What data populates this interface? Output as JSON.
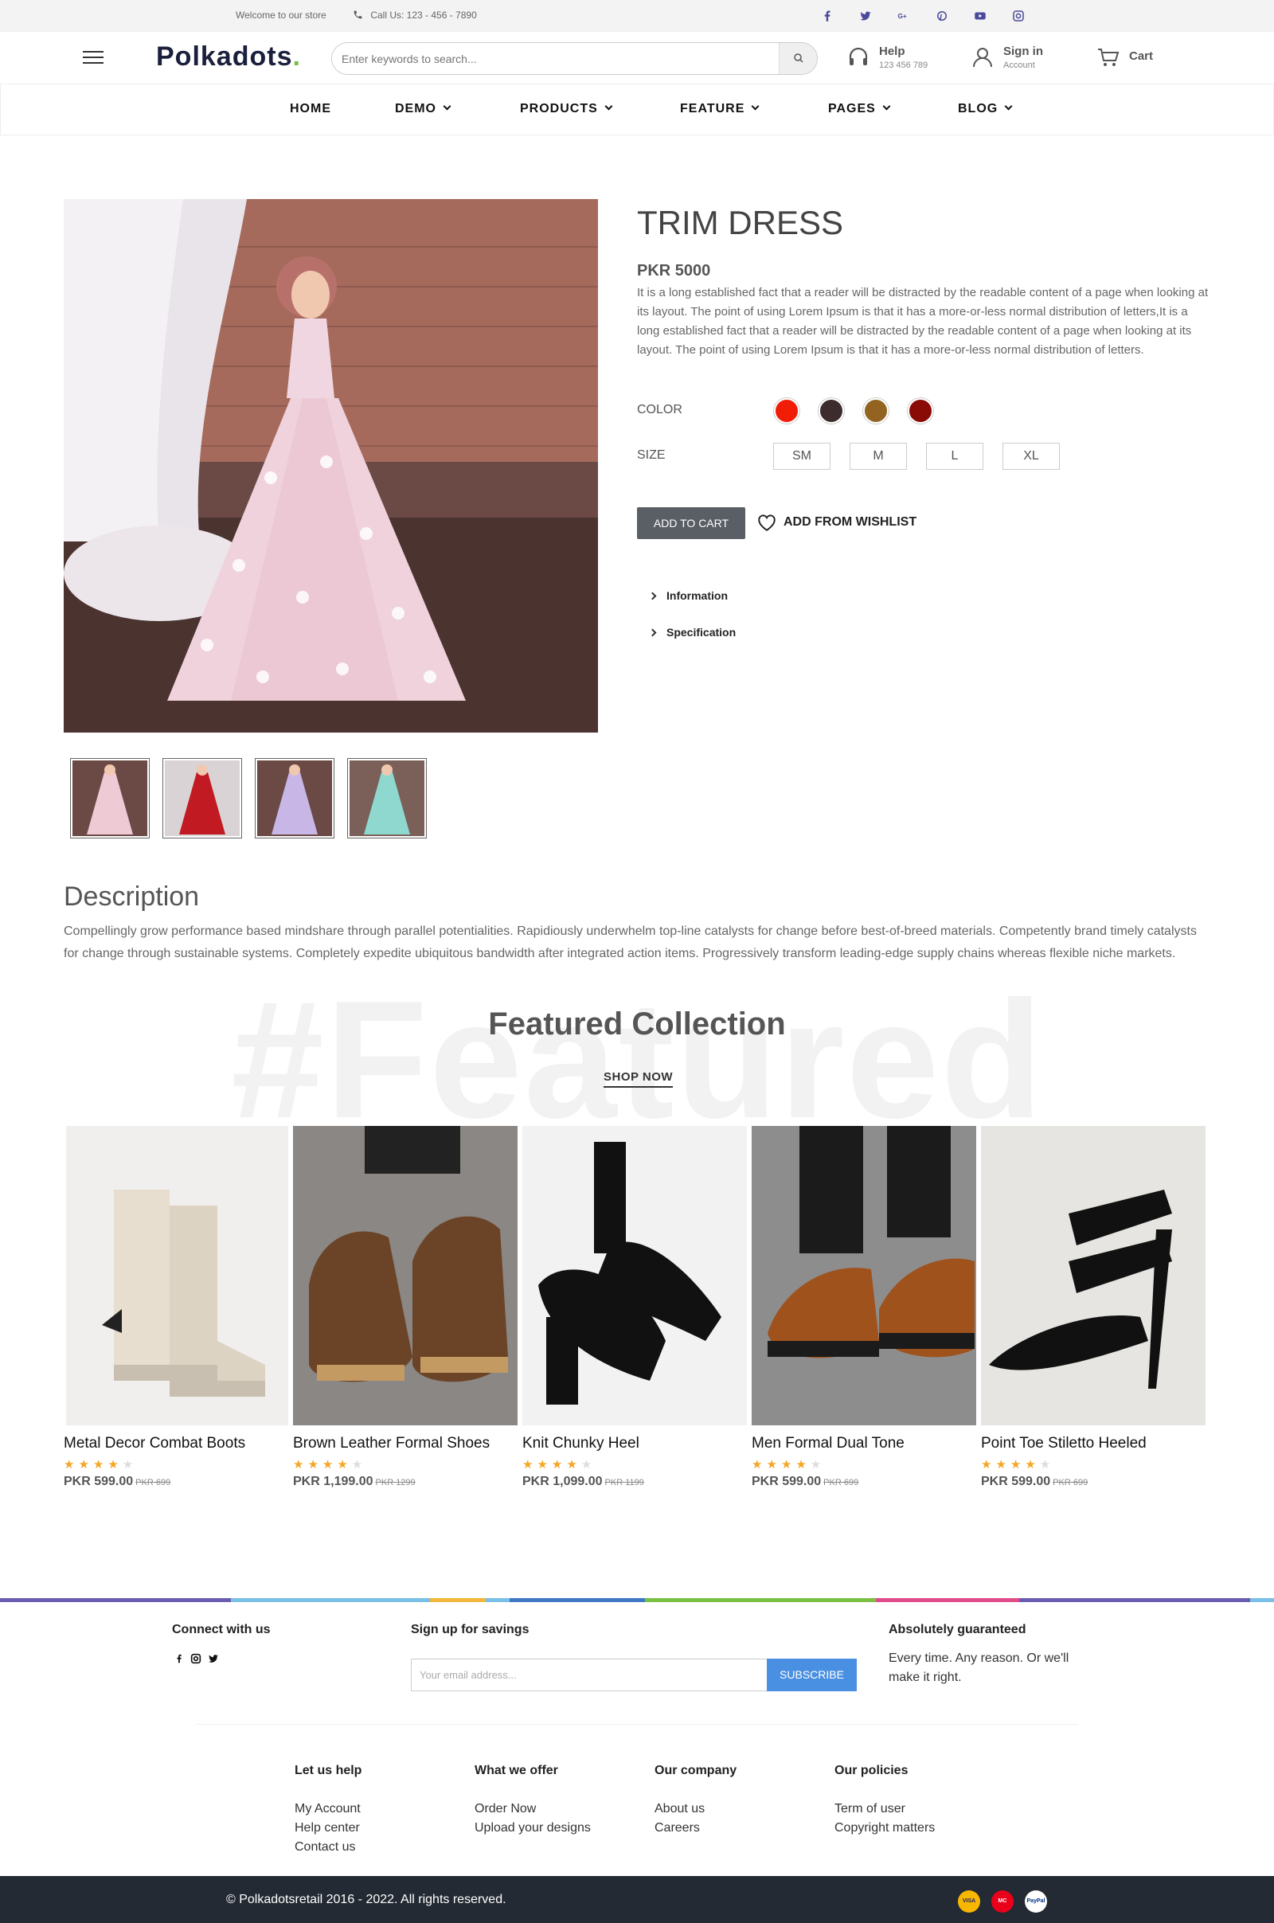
{
  "topbar": {
    "welcome": "Welcome to our store",
    "call": "Call Us: 123 - 456 - 7890"
  },
  "social_icons": [
    "facebook-icon",
    "twitter-icon",
    "google-plus-icon",
    "pinterest-icon",
    "youtube-icon",
    "instagram-icon"
  ],
  "header": {
    "logo_main": "Polkadots",
    "logo_dot": ".",
    "search_placeholder": "Enter keywords to search...",
    "help_title": "Help",
    "help_sub": "123 456 789",
    "signin_title": "Sign in",
    "signin_sub": "Account",
    "cart_label": "Cart"
  },
  "nav": [
    {
      "label": "HOME",
      "dropdown": false
    },
    {
      "label": "DEMO",
      "dropdown": true
    },
    {
      "label": "PRODUCTS",
      "dropdown": true
    },
    {
      "label": "FEATURE",
      "dropdown": true
    },
    {
      "label": "PAGES",
      "dropdown": true
    },
    {
      "label": "BLOG",
      "dropdown": true
    }
  ],
  "product": {
    "title": "TRIM DRESS",
    "price": "PKR 5000",
    "description": "It is a long established fact that a reader will be distracted by the readable content of a page when looking at its layout. The point of using Lorem Ipsum is that it has a more-or-less normal distribution of letters,It is a long established fact that a reader will be distracted by the readable content of a page when looking at its layout. The point of using Lorem Ipsum is that it has a more-or-less normal distribution of letters.",
    "color_label": "COLOR",
    "colors": [
      "#f21d07",
      "#3c2c2e",
      "#936421",
      "#8a0a06"
    ],
    "size_label": "SIZE",
    "sizes": [
      "SM",
      "M",
      "L",
      "XL"
    ],
    "add_to_cart": "ADD TO CART",
    "wishlist": "ADD FROM WISHLIST",
    "accordion": [
      "Information",
      "Specification"
    ],
    "thumbnail_colors": [
      "#eecad4",
      "#c21a22",
      "#c8b6e6",
      "#8fd8cf"
    ]
  },
  "description": {
    "title": "Description",
    "text": "Compellingly grow performance based mindshare through parallel potentialities. Rapidiously underwhelm top-line catalysts for change before best-of-breed materials. Competently brand timely catalysts for change through sustainable systems. Completely expedite ubiquitous bandwidth after integrated action items. Progressively transform leading-edge supply chains whereas flexible niche markets."
  },
  "featured": {
    "bg_word": "#Featured",
    "title": "Featured Collection",
    "shop_now": "SHOP NOW",
    "products": [
      {
        "name": "Metal Decor Combat Boots",
        "rating": 4,
        "price": "PKR 599.00",
        "old_price": "PKR 699"
      },
      {
        "name": "Brown Leather Formal Shoes",
        "rating": 4,
        "price": "PKR 1,199.00",
        "old_price": "PKR 1299"
      },
      {
        "name": "Knit Chunky Heel",
        "rating": 4,
        "price": "PKR 1,099.00",
        "old_price": "PKR 1199"
      },
      {
        "name": "Men Formal Dual Tone",
        "rating": 4,
        "price": "PKR 599.00",
        "old_price": "PKR 699"
      },
      {
        "name": "Point Toe Stiletto Heeled",
        "rating": 4,
        "price": "PKR 599.00",
        "old_price": "PKR 699"
      }
    ]
  },
  "footer": {
    "stripe_colors": [
      "#6a5db0",
      "#7ac0e6",
      "#f0b73a",
      "#7ac0e6",
      "#3f78c3",
      "#7ac143",
      "#e04c8a",
      "#6a5db0",
      "#7ac0e6"
    ],
    "connect_title": "Connect with us",
    "signup_title": "Sign up for savings",
    "email_placeholder": "Your email address...",
    "subscribe": "SUBSCRIBE",
    "guarantee_title": "Absolutely guaranteed",
    "guarantee_text": "Every time. Any reason. Or we'll make it right.",
    "columns": [
      {
        "title": "Let us help",
        "links": [
          "My Account",
          "Help center",
          "Contact us"
        ]
      },
      {
        "title": "What we offer",
        "links": [
          "Order Now",
          "Upload your designs"
        ]
      },
      {
        "title": "Our company",
        "links": [
          "About us",
          "Careers"
        ]
      },
      {
        "title": "Our policies",
        "links": [
          "Term of user",
          "Copyright matters"
        ]
      }
    ],
    "copyright": "© Polkadotsretail 2016 - 2022. All rights reserved.",
    "payments": [
      "VISA",
      "MC",
      "PayPal"
    ]
  }
}
